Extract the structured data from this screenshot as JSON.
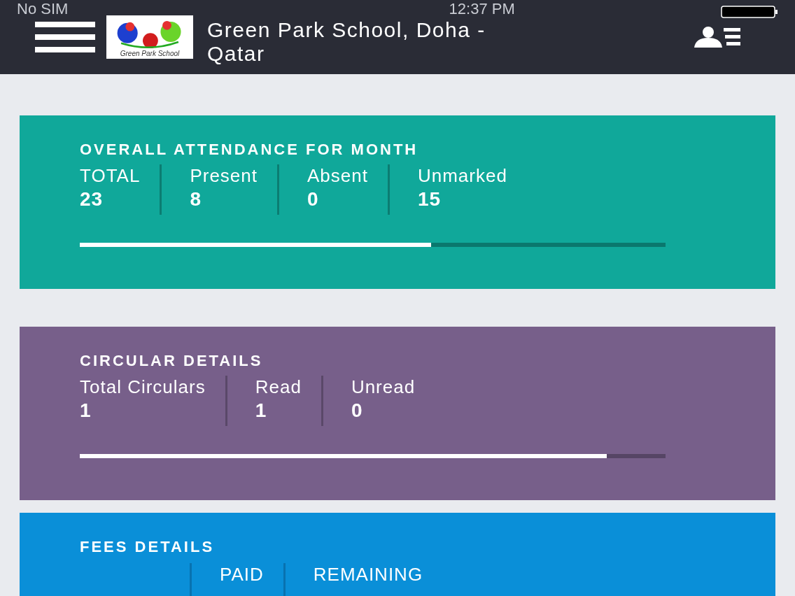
{
  "status_bar": {
    "carrier": "No SIM",
    "time": "12:37 PM"
  },
  "header": {
    "title": "Green Park School, Doha - Qatar",
    "logo_caption": "Green Park School"
  },
  "cards": [
    {
      "kind": "attendance",
      "title": "OVERALL ATTENDANCE FOR MONTH",
      "level": 0.6,
      "columns": [
        {
          "label": "TOTAL",
          "value": "23"
        },
        {
          "label": "Present",
          "value": "8"
        },
        {
          "label": "Absent",
          "value": "0"
        },
        {
          "label": "Unmarked",
          "value": "15"
        }
      ]
    },
    {
      "kind": "circular",
      "title": "CIRCULAR DETAILS",
      "level": 0.9,
      "columns": [
        {
          "label": "Total Circulars",
          "value": "1"
        },
        {
          "label": "Read",
          "value": "1"
        },
        {
          "label": "Unread",
          "value": "0"
        }
      ]
    },
    {
      "kind": "fees",
      "title": "FEES DETAILS",
      "columns": [
        {},
        {
          "label": "PAID"
        },
        {
          "label": "REMAINING"
        }
      ]
    }
  ]
}
